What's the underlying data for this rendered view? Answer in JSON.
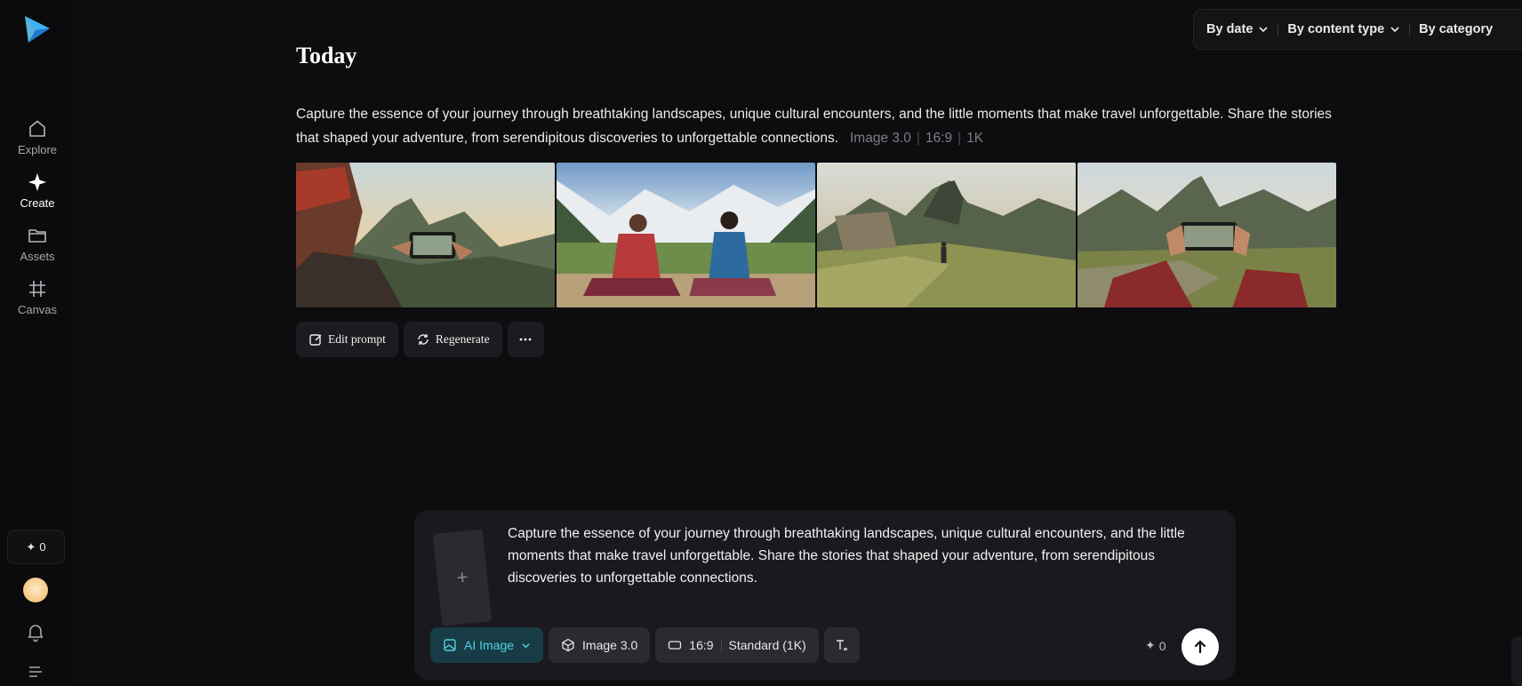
{
  "sidebar": {
    "items": [
      {
        "label": "Explore",
        "icon": "home-icon"
      },
      {
        "label": "Create",
        "icon": "sparkle-icon"
      },
      {
        "label": "Assets",
        "icon": "folder-icon"
      },
      {
        "label": "Canvas",
        "icon": "hash-grid-icon"
      }
    ],
    "credits": "0"
  },
  "filters": {
    "by_date": "By date",
    "by_content_type": "By content type",
    "by_category": "By category"
  },
  "section": {
    "title": "Today"
  },
  "generation": {
    "prompt": "Capture the essence of your journey through breathtaking landscapes, unique cultural encounters, and the little moments that make travel unforgettable. Share the stories that shaped your adventure, from serendipitous discoveries to unforgettable connections.",
    "model": "Image 3.0",
    "ratio": "16:9",
    "resolution": "1K",
    "images": [
      {
        "subject": "person-in-traditional-hat-photographing-mountains"
      },
      {
        "subject": "two-women-sitting-in-andean-valley"
      },
      {
        "subject": "hiker-on-machu-picchu-terraces"
      },
      {
        "subject": "hands-holding-phone-at-machu-picchu"
      }
    ],
    "actions": {
      "edit_prompt": "Edit prompt",
      "regenerate": "Regenerate"
    }
  },
  "composer": {
    "text": "Capture the essence of your journey through breathtaking landscapes, unique cultural encounters, and the little moments that make travel unforgettable. Share the stories that shaped your adventure, from serendipitous discoveries to unforgettable connections.",
    "mode": "AI Image",
    "model": "Image 3.0",
    "ratio": "16:9",
    "quality": "Standard (1K)",
    "credits": "0"
  },
  "colors": {
    "accent": "#4fd3e6",
    "background": "#0d0d10",
    "panel": "#1a1a1e"
  }
}
